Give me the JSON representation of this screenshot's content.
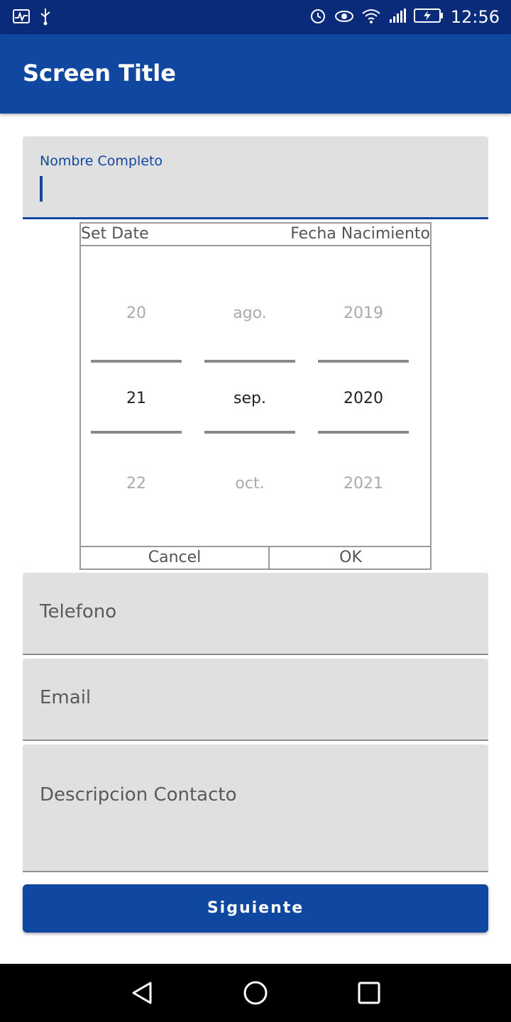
{
  "status_bar": {
    "time": "12:56",
    "left_icons": [
      "activity-icon",
      "usb-icon"
    ],
    "right_icons": [
      "alarm-icon",
      "eye-icon",
      "wifi-icon",
      "signal-icon",
      "battery-icon"
    ]
  },
  "app_bar": {
    "title": "Screen Title"
  },
  "form": {
    "nombre_label": "Nombre Completo",
    "telefono_label": "Telefono",
    "email_label": "Email",
    "descripcion_label": "Descripcion Contacto",
    "submit_label": "Siguiente"
  },
  "date_dialog": {
    "title_left": "Set Date",
    "title_right": "Fecha Nacimiento",
    "day": {
      "prev": "20",
      "current": "21",
      "next": "22"
    },
    "month": {
      "prev": "ago.",
      "current": "sep.",
      "next": "oct."
    },
    "year": {
      "prev": "2019",
      "current": "2020",
      "next": "2021"
    },
    "cancel_label": "Cancel",
    "ok_label": "OK"
  },
  "colors": {
    "status_bar": "#0a2a7a",
    "primary": "#0f47a1",
    "field_bg": "#e0e0e0"
  },
  "nav_bar": {
    "icons": [
      "back-icon",
      "home-icon",
      "recents-icon"
    ]
  }
}
